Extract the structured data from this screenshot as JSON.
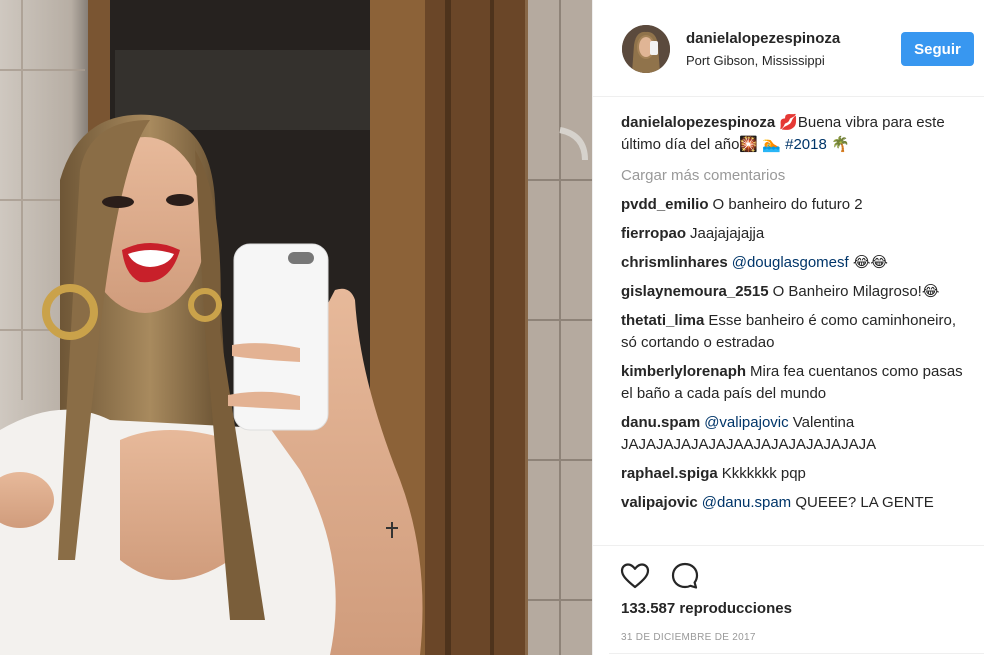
{
  "post": {
    "username": "danielalopezespinoza",
    "location": "Port Gibson, Mississippi",
    "follow_label": "Seguir"
  },
  "caption": {
    "username": "danielalopezespinoza",
    "text": "💋Buena vibra para este último día del año🎇 🏊 ",
    "hashtag": "#2018",
    "suffix": " 🌴"
  },
  "load_more_label": "Cargar más comentarios",
  "comments": [
    {
      "user": "pvdd_emilio",
      "mention": "",
      "text": "O banheiro do futuro 2"
    },
    {
      "user": "fierropao",
      "mention": "",
      "text": "Jaajajajajja"
    },
    {
      "user": "chrismlinhares",
      "mention": "@douglasgomesf",
      "text": " 😂😂"
    },
    {
      "user": "gislaynemoura_2515",
      "mention": "",
      "text": "O Banheiro Milagroso!😂"
    },
    {
      "user": "thetati_lima",
      "mention": "",
      "text": "Esse banheiro é como caminhoneiro, só cortando o estradao"
    },
    {
      "user": "kimberlylorenaph",
      "mention": "",
      "text": "Mira fea cuentanos como pasas el baño a cada país del mundo"
    },
    {
      "user": "danu.spam",
      "mention": "@valipajovic",
      "text": " Valentina JAJAJAJAJAJAJAAJAJAJAJAJAJAJA"
    },
    {
      "user": "raphael.spiga",
      "mention": "",
      "text": "Kkkkkkk pqp"
    },
    {
      "user": "valipajovic",
      "mention": "@danu.spam",
      "text": " QUEEE? LA GENTE"
    }
  ],
  "stats": {
    "views": "133.587 reproducciones",
    "date": "31 DE DICIEMBRE DE 2017"
  },
  "icons": {
    "like": "heart-icon",
    "comment": "speech-bubble-icon"
  },
  "colors": {
    "follow_button": "#3897f0",
    "mention": "#003569",
    "muted": "#999999"
  }
}
